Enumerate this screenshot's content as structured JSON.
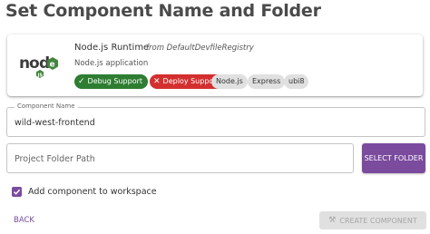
{
  "page": {
    "title": "Set Component Name and Folder"
  },
  "devfile_card": {
    "logo_alt": "node",
    "runtime_name": "Node.js Runtime",
    "registry": "from DefaultDevfileRegistry",
    "runtime_type": "Node.js application",
    "chips": {
      "debug_support": {
        "label": "Debug Support",
        "icon": "check-icon",
        "color": "#2e7d32"
      },
      "deploy_support": {
        "label": "Deploy Support",
        "icon": "close-icon",
        "color": "#d32f2f"
      },
      "tags": [
        "Node.js",
        "Express",
        "ubi8"
      ]
    }
  },
  "component_name": {
    "label": "Component Name",
    "value": "wild-west-frontend"
  },
  "project_folder": {
    "placeholder": "Project Folder Path",
    "select_button_label": "SELECT FOLDER"
  },
  "workspace_checkbox": {
    "label": "Add component to workspace",
    "checked": true
  },
  "footer": {
    "back_label": "BACK",
    "create_label": "CREATE COMPONENT",
    "create_enabled": false
  },
  "colors": {
    "accent": "#7b4b9e",
    "success": "#2e7d32",
    "error": "#d32f2f",
    "node_green": "#43853d"
  }
}
